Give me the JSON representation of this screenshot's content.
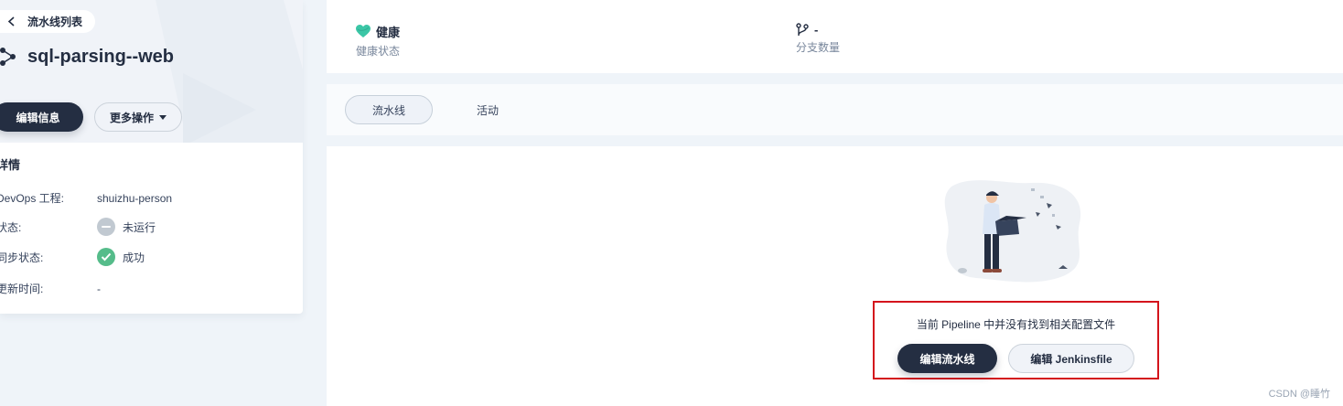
{
  "sidebar": {
    "back_label": "流水线列表",
    "title": "sql-parsing--web",
    "edit_info_label": "编辑信息",
    "more_actions_label": "更多操作",
    "details_heading": "详情",
    "details": [
      {
        "key": "DevOps 工程:",
        "value": "shuizhu-person"
      },
      {
        "key": "状态:",
        "value": "未运行",
        "status": "not-run",
        "color": "#c1c9d1"
      },
      {
        "key": "同步状态:",
        "value": "成功",
        "status": "success",
        "color": "#55bc8a"
      },
      {
        "key": "更新时间:",
        "value": "-"
      }
    ]
  },
  "stats": {
    "health": {
      "value": "健康",
      "label": "健康状态",
      "icon": "heart-icon",
      "color": "#3bc6a6"
    },
    "branches": {
      "value": "-",
      "label": "分支数量",
      "icon": "branch-icon"
    }
  },
  "tabs": [
    {
      "label": "流水线",
      "active": true
    },
    {
      "label": "活动",
      "active": false
    }
  ],
  "empty_state": {
    "message": "当前 Pipeline 中并没有找到相关配置文件",
    "edit_pipeline_label": "编辑流水线",
    "edit_jenkinsfile_label": "编辑 Jenkinsfile",
    "highlight_color": "#d4141c"
  },
  "watermark": "CSDN @睡竹"
}
